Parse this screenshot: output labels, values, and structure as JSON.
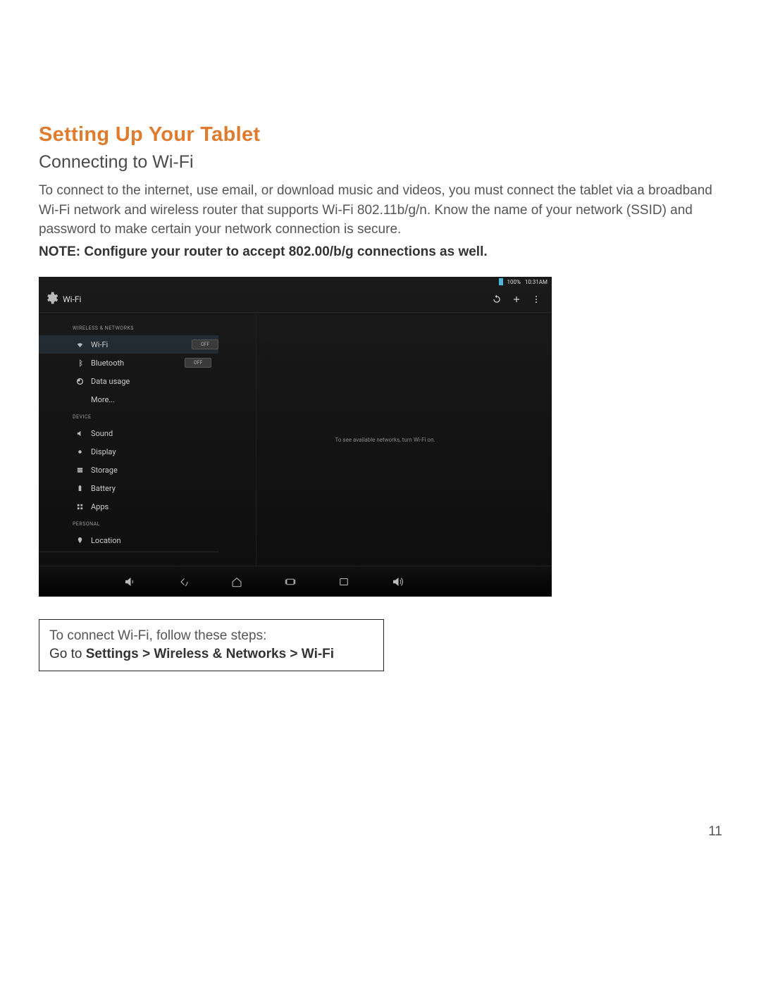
{
  "doc": {
    "title": "Setting Up Your Tablet",
    "subtitle": "Connecting to Wi-Fi",
    "intro": "To connect to the internet, use email, or download music and videos, you must connect the tablet via a broadband Wi-Fi network and wireless router that supports Wi-Fi 802.11b/g/n. Know the name of your network (SSID) and password to make certain your network connection is secure.",
    "note": "NOTE: Configure your router to accept 802.00/b/g connections as well.",
    "instr_intro": "To connect Wi-Fi, follow these steps:",
    "instr_prefix": "Go to ",
    "instr_path": "Settings > Wireless & Networks > Wi-Fi",
    "page_number": "11"
  },
  "tablet": {
    "status": {
      "battery_pct": "100%",
      "time": "10:31AM"
    },
    "appbar": {
      "title": "Wi-Fi"
    },
    "sections": {
      "wireless": "WIRELESS & NETWORKS",
      "device": "DEVICE",
      "personal": "PERSONAL"
    },
    "items": {
      "wifi": "Wi-Fi",
      "wifi_toggle": "OFF",
      "bluetooth": "Bluetooth",
      "bluetooth_toggle": "OFF",
      "data_usage": "Data usage",
      "more": "More...",
      "sound": "Sound",
      "display": "Display",
      "storage": "Storage",
      "battery": "Battery",
      "apps": "Apps",
      "location": "Location"
    },
    "content_msg": "To see available networks, turn Wi-Fi on."
  }
}
